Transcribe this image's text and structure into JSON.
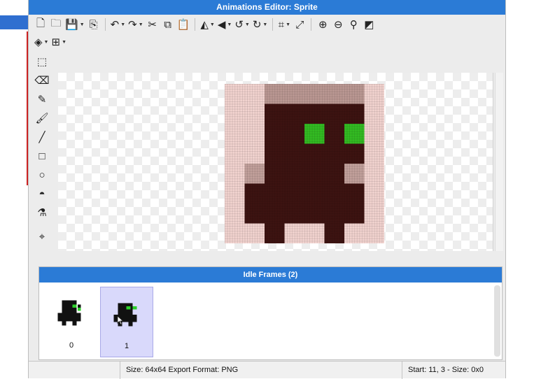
{
  "window": {
    "title": "Animations Editor: Sprite"
  },
  "toolbar": {
    "row1": [
      {
        "icon": "new-file-icon",
        "glyph": "🗋",
        "caret": false
      },
      {
        "icon": "open-folder-icon",
        "glyph": "🗀",
        "caret": false
      },
      {
        "icon": "save-icon",
        "glyph": "💾",
        "caret": true
      },
      {
        "icon": "export-icon",
        "glyph": "⎘",
        "caret": false
      },
      {
        "sep": true
      },
      {
        "icon": "undo-icon",
        "glyph": "↶",
        "caret": true
      },
      {
        "icon": "redo-icon",
        "glyph": "↷",
        "caret": true
      },
      {
        "icon": "cut-icon",
        "glyph": "✂",
        "caret": false
      },
      {
        "icon": "copy-icon",
        "glyph": "⧉",
        "caret": false
      },
      {
        "icon": "paste-icon",
        "glyph": "📋",
        "caret": false
      },
      {
        "sep": true
      },
      {
        "icon": "flip-horizontal-icon",
        "glyph": "◭",
        "caret": true
      },
      {
        "icon": "flip-vertical-icon",
        "glyph": "◀",
        "caret": true
      },
      {
        "icon": "rotate-left-icon",
        "glyph": "↺",
        "caret": true
      },
      {
        "icon": "rotate-right-icon",
        "glyph": "↻",
        "caret": true
      },
      {
        "sep": true
      },
      {
        "icon": "crop-icon",
        "glyph": "⌗",
        "caret": true
      },
      {
        "icon": "resize-icon",
        "glyph": "⤢",
        "caret": false
      },
      {
        "sep": true
      },
      {
        "icon": "zoom-in-icon",
        "glyph": "⊕",
        "caret": false
      },
      {
        "icon": "zoom-out-icon",
        "glyph": "⊖",
        "caret": false
      },
      {
        "icon": "zoom-fit-icon",
        "glyph": "⚲",
        "caret": false
      },
      {
        "icon": "transparency-icon",
        "glyph": "◩",
        "caret": false
      }
    ],
    "row2": [
      {
        "icon": "layers-icon",
        "glyph": "◈",
        "caret": true
      },
      {
        "icon": "grid-icon",
        "glyph": "⊞",
        "caret": true
      }
    ]
  },
  "tools": [
    {
      "icon": "select-icon",
      "glyph": "⬚"
    },
    {
      "icon": "eraser-icon",
      "glyph": "⌫"
    },
    {
      "icon": "pencil-icon",
      "glyph": "✎"
    },
    {
      "icon": "brush-icon",
      "glyph": "🖌"
    },
    {
      "icon": "line-icon",
      "glyph": "╱"
    },
    {
      "icon": "rectangle-icon",
      "glyph": "□"
    },
    {
      "icon": "ellipse-icon",
      "glyph": "○"
    },
    {
      "icon": "fill-bucket-icon",
      "glyph": "◓"
    },
    {
      "icon": "eyedropper-icon",
      "glyph": "⚗"
    },
    {
      "icon": "anchor-point-icon",
      "glyph": "⌖",
      "gap": true
    }
  ],
  "sprite": {
    "grid_size": 64,
    "colors": {
      "body": "#3d1311",
      "eyes": "#33bb22",
      "margin": "#f2d3cf",
      "top": "#bb9893",
      "side": "#c2a09b"
    }
  },
  "frames_panel": {
    "title": "Idle Frames (2)",
    "frames": [
      {
        "label": "0",
        "selected": false
      },
      {
        "label": "1",
        "selected": true
      }
    ]
  },
  "status": {
    "left": "Size: 64x64   Export Format: PNG",
    "right": "Start: 11, 3 - Size: 0x0"
  }
}
